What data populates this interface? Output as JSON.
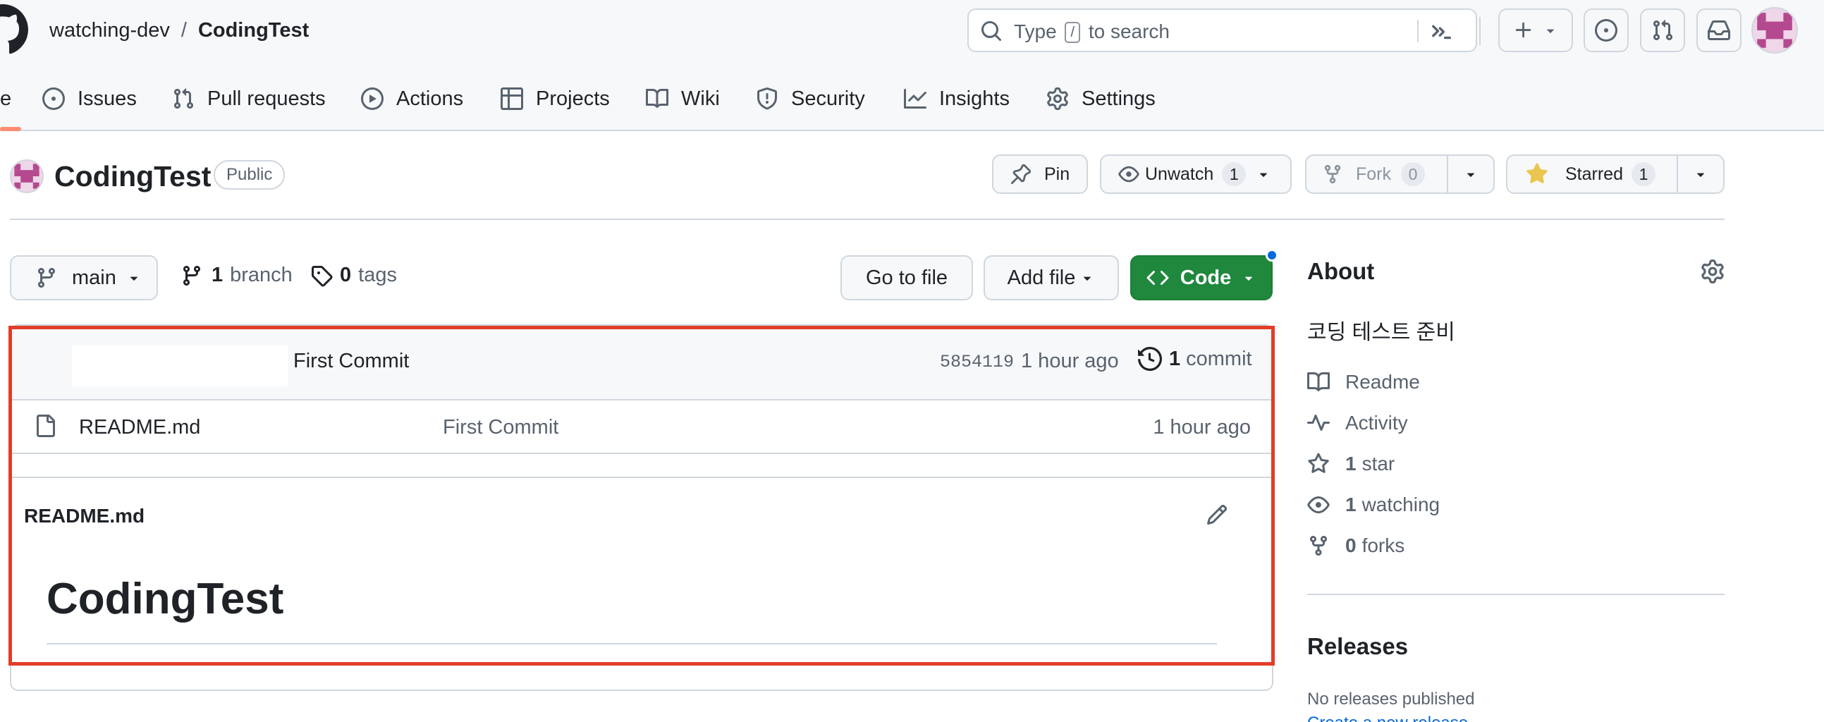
{
  "header": {
    "owner": "watching-dev",
    "separator": "/",
    "repo": "CodingTest",
    "search": {
      "prefix": "Type",
      "key": "/",
      "suffix": "to search"
    }
  },
  "tabs": [
    {
      "label": "e",
      "icon": "code-icon"
    },
    {
      "label": "Issues",
      "icon": "issue-icon"
    },
    {
      "label": "Pull requests",
      "icon": "pull-request-icon"
    },
    {
      "label": "Actions",
      "icon": "play-icon"
    },
    {
      "label": "Projects",
      "icon": "table-icon"
    },
    {
      "label": "Wiki",
      "icon": "book-icon"
    },
    {
      "label": "Security",
      "icon": "shield-icon"
    },
    {
      "label": "Insights",
      "icon": "graph-icon"
    },
    {
      "label": "Settings",
      "icon": "gear-icon"
    }
  ],
  "repo": {
    "name": "CodingTest",
    "visibility": "Public",
    "pin_label": "Pin",
    "unwatch_label": "Unwatch",
    "watch_count": "1",
    "fork_label": "Fork",
    "fork_count": "0",
    "starred_label": "Starred",
    "star_count": "1"
  },
  "branch": {
    "current": "main",
    "branch_count": "1",
    "branch_label": "branch",
    "tag_count": "0",
    "tag_label": "tags",
    "goto_label": "Go to file",
    "addfile_label": "Add file",
    "code_label": "Code"
  },
  "commit": {
    "message": "First Commit",
    "sha": "5854119",
    "time": "1 hour ago",
    "count": "1",
    "count_label": "commit"
  },
  "files": [
    {
      "name": "README.md",
      "commit": "First Commit",
      "time": "1 hour ago"
    }
  ],
  "readme": {
    "filename": "README.md",
    "heading": "CodingTest"
  },
  "about": {
    "title": "About",
    "description": "코딩 테스트 준비",
    "readme": "Readme",
    "activity": "Activity",
    "stars": "1",
    "stars_label": "star",
    "watching": "1",
    "watching_label": "watching",
    "forks": "0",
    "forks_label": "forks"
  },
  "releases": {
    "title": "Releases",
    "none": "No releases published",
    "create": "Create a new release"
  },
  "colors": {
    "accent_green": "#1f883d",
    "link_blue": "#0969da",
    "highlight_red": "#e23d27",
    "star_yellow": "#eac54f"
  }
}
